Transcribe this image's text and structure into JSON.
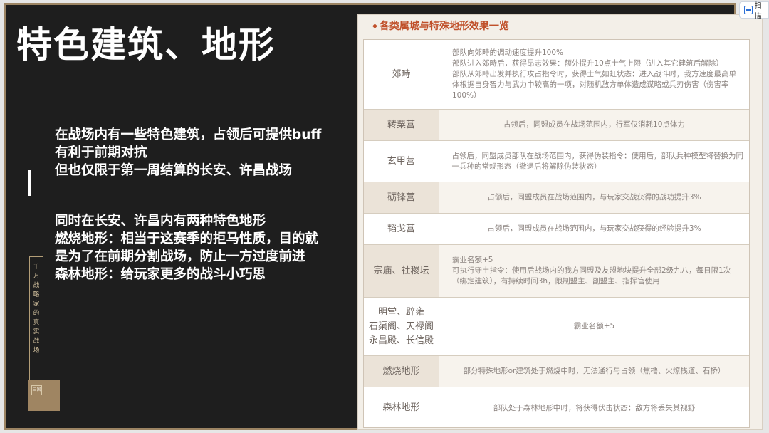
{
  "slide": {
    "title": "特色建筑、地形",
    "para1": [
      "在战场内有一些特色建筑，占领后可提供buff",
      "有利于前期对抗",
      "但也仅限于第一周结算的长安、许昌战场"
    ],
    "para2": [
      "同时在长安、许昌内有两种特色地形",
      "燃烧地形：相当于这赛季的拒马性质，目的就",
      "是为了在前期分割战场，防止一方过度前进",
      "森林地形：给玩家更多的战斗小巧思"
    ],
    "vertical_text": [
      "千",
      "万",
      "战",
      "略",
      "家",
      "的",
      "真",
      "实",
      "战",
      "场"
    ],
    "badge_text": "三国"
  },
  "panel": {
    "heading": "各类属城与特殊地形效果一览",
    "rows": [
      {
        "name": [
          "郊畤"
        ],
        "desc": [
          "部队向郊畤的调动速度提升100%",
          "部队进入郊畤后，获得昂志效果：额外提升10点士气上限（进入其它建筑后解除）",
          "部队从郊畤出发并执行攻占指令时，获得士气如虹状态：进入战斗时，我方速度最高单",
          "体根据自身智力与武力中较高的一项，对随机敌方单体造成谋略或兵刃伤害（伤害率",
          "100%）"
        ]
      },
      {
        "name": [
          "转粟营"
        ],
        "desc": [
          "占领后，同盟成员在战场范围内，行军仅消耗10点体力"
        ],
        "center": true
      },
      {
        "name": [
          "玄甲营"
        ],
        "desc": [
          "占领后，同盟成员部队在战场范围内，获得伪装指令：使用后，部队兵种模型将替换为同",
          "一兵种的常规形态（撤退后将解除伪装状态）"
        ]
      },
      {
        "name": [
          "砺锋营"
        ],
        "desc": [
          "占领后，同盟成员在战场范围内，与玩家交战获得的战功提升3%"
        ],
        "center": true
      },
      {
        "name": [
          "韬戈营"
        ],
        "desc": [
          "占领后，同盟成员在战场范围内，与玩家交战获得的经验提升3%"
        ],
        "center": true
      },
      {
        "name": [
          "宗庙、社稷坛"
        ],
        "desc": [
          "霸业名额+5",
          "可执行守土指令：使用后战场内的我方同盟及友盟地块提升全部2级九八，每日限1次",
          "（绑定建筑），有持续时间3h，限制盟主、副盟主、指挥官使用"
        ]
      },
      {
        "name": [
          "明堂、辟雍",
          "石渠阁、天禄阁",
          "永昌殿、长信殿"
        ],
        "desc": [
          "霸业名额+5"
        ],
        "center": true
      },
      {
        "name": [
          "燃烧地形"
        ],
        "desc": [
          "部分特殊地形or建筑处于燃烧中时，无法通行与占领（焦橹、火燎栈道、石桥）"
        ],
        "center": true
      },
      {
        "name": [
          "森林地形"
        ],
        "desc": [
          "部队处于森林地形中时，将获得伏击状态：敌方将丢失其视野"
        ],
        "center": true
      }
    ]
  },
  "toolbar": {
    "scan_label": "扫描"
  }
}
